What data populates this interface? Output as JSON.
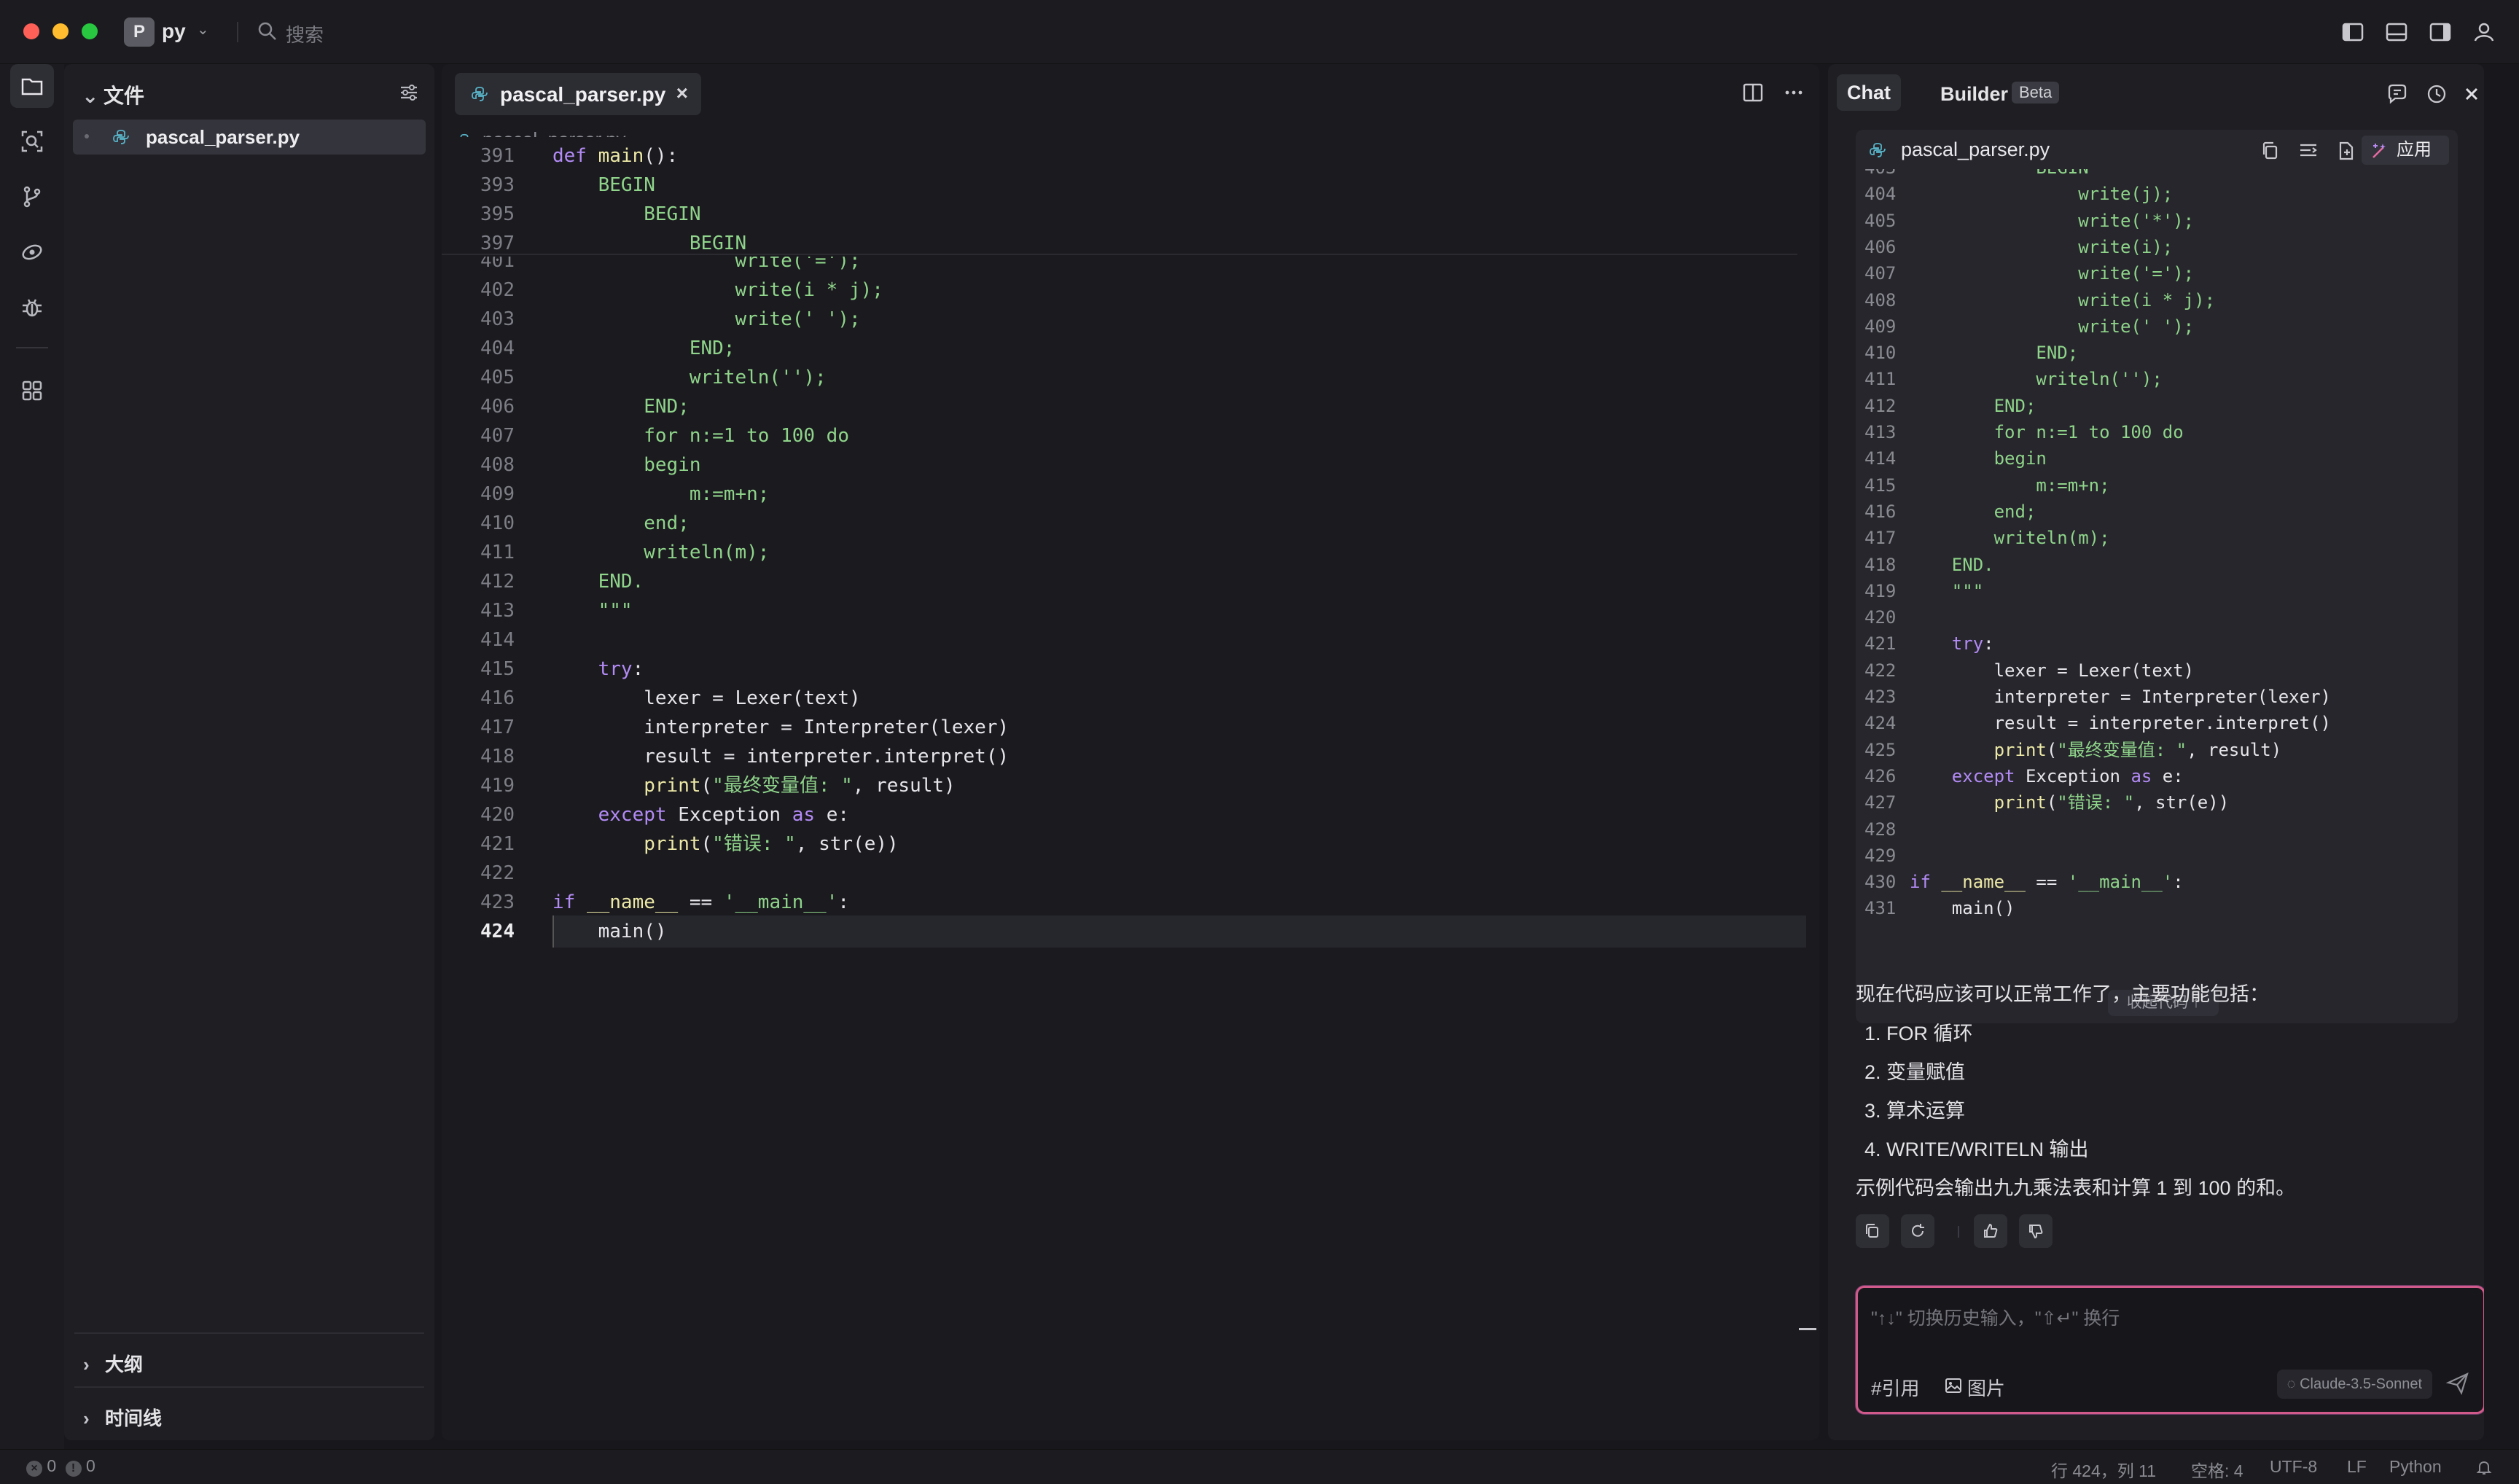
{
  "titlebar": {
    "project_initial": "P",
    "project_name": "py",
    "search_label": "搜索",
    "traffic_colors": [
      "#fe5f57",
      "#febc2e",
      "#28c840"
    ]
  },
  "activitybar": {
    "icons": [
      "files-icon",
      "search-icon",
      "source-control-icon",
      "extensions-eye-icon",
      "debug-icon",
      "apps-icon"
    ]
  },
  "explorer": {
    "title": "文件",
    "files": [
      "pascal_parser.py"
    ],
    "sections": [
      "大纲",
      "时间线"
    ]
  },
  "editor": {
    "tab_name": "pascal_parser.py",
    "close_glyph": "×",
    "breadcrumb": "pascal_parser.py",
    "sticky": [
      {
        "ln": "391",
        "text": "def main():"
      },
      {
        "ln": "393",
        "text": "    BEGIN"
      },
      {
        "ln": "395",
        "text": "        BEGIN"
      },
      {
        "ln": "397",
        "text": "            BEGIN"
      }
    ],
    "lines": [
      {
        "ln": "401",
        "text": "                write('=');"
      },
      {
        "ln": "402",
        "text": "                write(i * j);"
      },
      {
        "ln": "403",
        "text": "                write(' ');"
      },
      {
        "ln": "404",
        "text": "            END;"
      },
      {
        "ln": "405",
        "text": "            writeln('');"
      },
      {
        "ln": "406",
        "text": "        END;"
      },
      {
        "ln": "407",
        "text": "        for n:=1 to 100 do"
      },
      {
        "ln": "408",
        "text": "        begin"
      },
      {
        "ln": "409",
        "text": "            m:=m+n;"
      },
      {
        "ln": "410",
        "text": "        end;"
      },
      {
        "ln": "411",
        "text": "        writeln(m);"
      },
      {
        "ln": "412",
        "text": "    END."
      },
      {
        "ln": "413",
        "text": "    \"\"\""
      },
      {
        "ln": "414",
        "text": ""
      },
      {
        "ln": "415",
        "text": "    try:"
      },
      {
        "ln": "416",
        "text": "        lexer = Lexer(text)"
      },
      {
        "ln": "417",
        "text": "        interpreter = Interpreter(lexer)"
      },
      {
        "ln": "418",
        "text": "        result = interpreter.interpret()"
      },
      {
        "ln": "419",
        "text": "        print(\"最终变量值: \", result)"
      },
      {
        "ln": "420",
        "text": "    except Exception as e:"
      },
      {
        "ln": "421",
        "text": "        print(\"错误: \", str(e))"
      },
      {
        "ln": "422",
        "text": ""
      },
      {
        "ln": "423",
        "text": "if __name__ == '__main__':"
      },
      {
        "ln": "424",
        "text": "    main()"
      }
    ],
    "current_line": "424"
  },
  "chat": {
    "tab_chat": "Chat",
    "tab_builder": "Builder",
    "builder_badge": "Beta",
    "code_card": {
      "file": "pascal_parser.py",
      "apply_label": "应用",
      "lines": [
        {
          "ln": "403",
          "text": "            BEGIN"
        },
        {
          "ln": "404",
          "text": "                write(j);"
        },
        {
          "ln": "405",
          "text": "                write('*');"
        },
        {
          "ln": "406",
          "text": "                write(i);"
        },
        {
          "ln": "407",
          "text": "                write('=');"
        },
        {
          "ln": "408",
          "text": "                write(i * j);"
        },
        {
          "ln": "409",
          "text": "                write(' ');"
        },
        {
          "ln": "410",
          "text": "            END;"
        },
        {
          "ln": "411",
          "text": "            writeln('');"
        },
        {
          "ln": "412",
          "text": "        END;"
        },
        {
          "ln": "413",
          "text": "        for n:=1 to 100 do"
        },
        {
          "ln": "414",
          "text": "        begin"
        },
        {
          "ln": "415",
          "text": "            m:=m+n;"
        },
        {
          "ln": "416",
          "text": "        end;"
        },
        {
          "ln": "417",
          "text": "        writeln(m);"
        },
        {
          "ln": "418",
          "text": "    END."
        },
        {
          "ln": "419",
          "text": "    \"\"\""
        },
        {
          "ln": "420",
          "text": ""
        },
        {
          "ln": "421",
          "text": "    try:"
        },
        {
          "ln": "422",
          "text": "        lexer = Lexer(text)"
        },
        {
          "ln": "423",
          "text": "        interpreter = Interpreter(lexer)"
        },
        {
          "ln": "424",
          "text": "        result = interpreter.interpret()"
        },
        {
          "ln": "425",
          "text": "        print(\"最终变量值: \", result)"
        },
        {
          "ln": "426",
          "text": "    except Exception as e:"
        },
        {
          "ln": "427",
          "text": "        print(\"错误: \", str(e))"
        },
        {
          "ln": "428",
          "text": ""
        },
        {
          "ln": "429",
          "text": ""
        },
        {
          "ln": "430",
          "text": "if __name__ == '__main__':"
        },
        {
          "ln": "431",
          "text": "    main()"
        }
      ],
      "collapse_label": "收起代码 ↑"
    },
    "message": {
      "intro": "现在代码应该可以正常工作了，主要功能包括：",
      "items": [
        "1. FOR 循环",
        "2. 变量赋值",
        "3. 算术运算",
        "4. WRITE/WRITELN 输出"
      ],
      "outro": "示例代码会输出九九乘法表和计算 1 到 100 的和。"
    },
    "input": {
      "placeholder": "\"↑↓\" 切换历史输入，\"⇧↵\" 换行",
      "ref_label": "#引用",
      "image_label": "图片",
      "model": "Claude-3.5-Sonnet"
    },
    "accent_color": "#d05a8a"
  },
  "statusbar": {
    "errors": "0",
    "warnings": "0",
    "cursor": "行 424，列 11",
    "spaces": "空格: 4",
    "encoding": "UTF-8",
    "eol": "LF",
    "language": "Python"
  }
}
